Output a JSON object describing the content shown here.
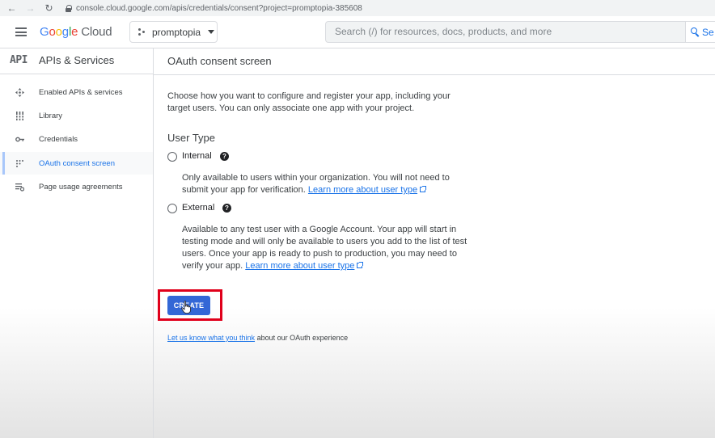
{
  "browser": {
    "url": "console.cloud.google.com/apis/credentials/consent?project=promptopia-385608"
  },
  "header": {
    "logo_google": "Google",
    "logo_cloud": "Cloud",
    "project_name": "promptopia",
    "search_placeholder": "Search (/) for resources, docs, products, and more",
    "search_button_label": "Se"
  },
  "sidebar": {
    "badge": "API",
    "title": "APIs & Services",
    "items": [
      {
        "label": "Enabled APIs & services",
        "icon": "move-icon",
        "active": false
      },
      {
        "label": "Library",
        "icon": "library-icon",
        "active": false
      },
      {
        "label": "Credentials",
        "icon": "key-icon",
        "active": false
      },
      {
        "label": "OAuth consent screen",
        "icon": "consent-dots-icon",
        "active": true
      },
      {
        "label": "Page usage agreements",
        "icon": "settings-list-icon",
        "active": false
      }
    ]
  },
  "main": {
    "title": "OAuth consent screen",
    "intro": "Choose how you want to configure and register your app, including your target users. You can only associate one app with your project.",
    "user_type_title": "User Type",
    "internal": {
      "label": "Internal",
      "selected": false,
      "description": "Only available to users within your organization. You will not need to submit your app for verification.",
      "link": "Learn more about user type"
    },
    "external": {
      "label": "External",
      "selected": false,
      "description": "Available to any test user with a Google Account. Your app will start in testing mode and will only be available to users you add to the list of test users. Once your app is ready to push to production, you may need to verify your app.",
      "link": "Learn more about user type"
    },
    "create_button": "CREATE",
    "feedback_link": "Let us know what you think",
    "feedback_text": " about our OAuth experience"
  },
  "colors": {
    "accent": "#1a73e8",
    "create_button": "#3367d6",
    "highlight_box": "#e0001b"
  }
}
